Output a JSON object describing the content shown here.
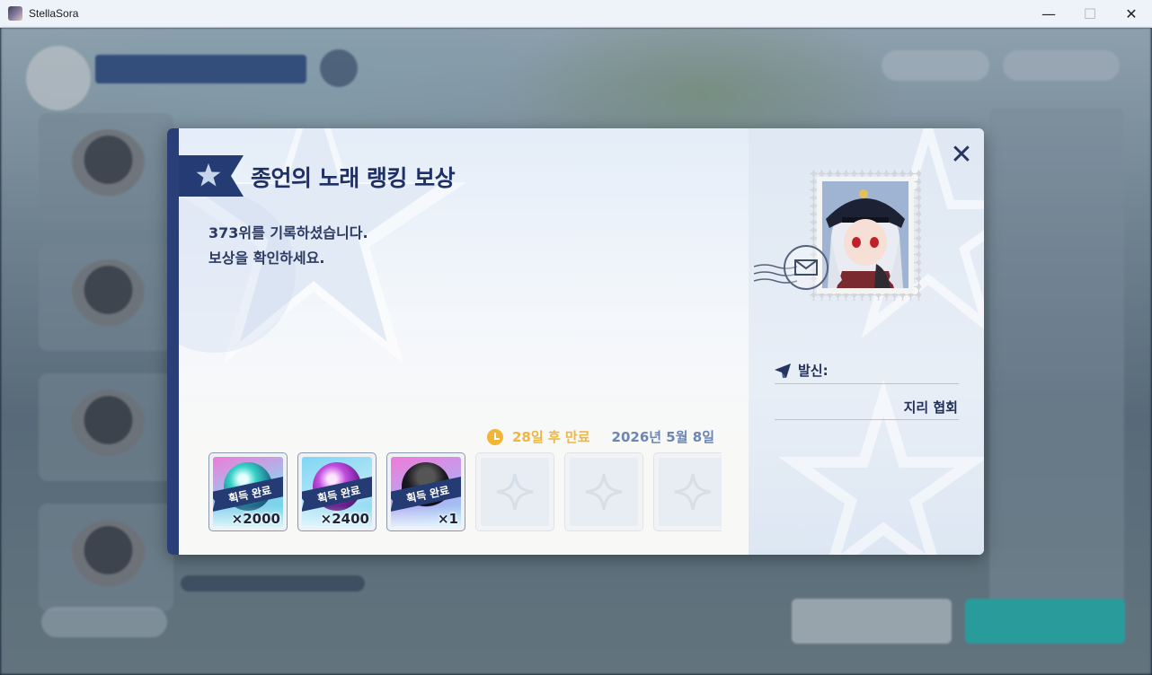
{
  "window": {
    "title": "StellaSora",
    "minimize": "—",
    "maximize": "☐",
    "close": "✕"
  },
  "dialog": {
    "title": "종언의 노래 랭킹 보상",
    "message_line1": "373위를 기록하셨습니다.",
    "message_line2": "보상을 확인하세요.",
    "expire_text": "28일 후 만료",
    "expire_date": "2026년 5월 8일",
    "close_glyph": "✕"
  },
  "rewards": [
    {
      "badge": "획득 완료",
      "count": "×2000",
      "icon": "gem-teal-icon"
    },
    {
      "badge": "획득 완료",
      "count": "×2400",
      "icon": "gem-purple-icon"
    },
    {
      "badge": "획득 완료",
      "count": "×1",
      "icon": "hat-item-icon"
    }
  ],
  "empty_slots": 3,
  "sender": {
    "label": "발신:",
    "name": "지리 협회"
  },
  "colors": {
    "accent_navy": "#2a3f78",
    "expire_gold": "#f0b643",
    "date_blue": "#6c86b3"
  }
}
